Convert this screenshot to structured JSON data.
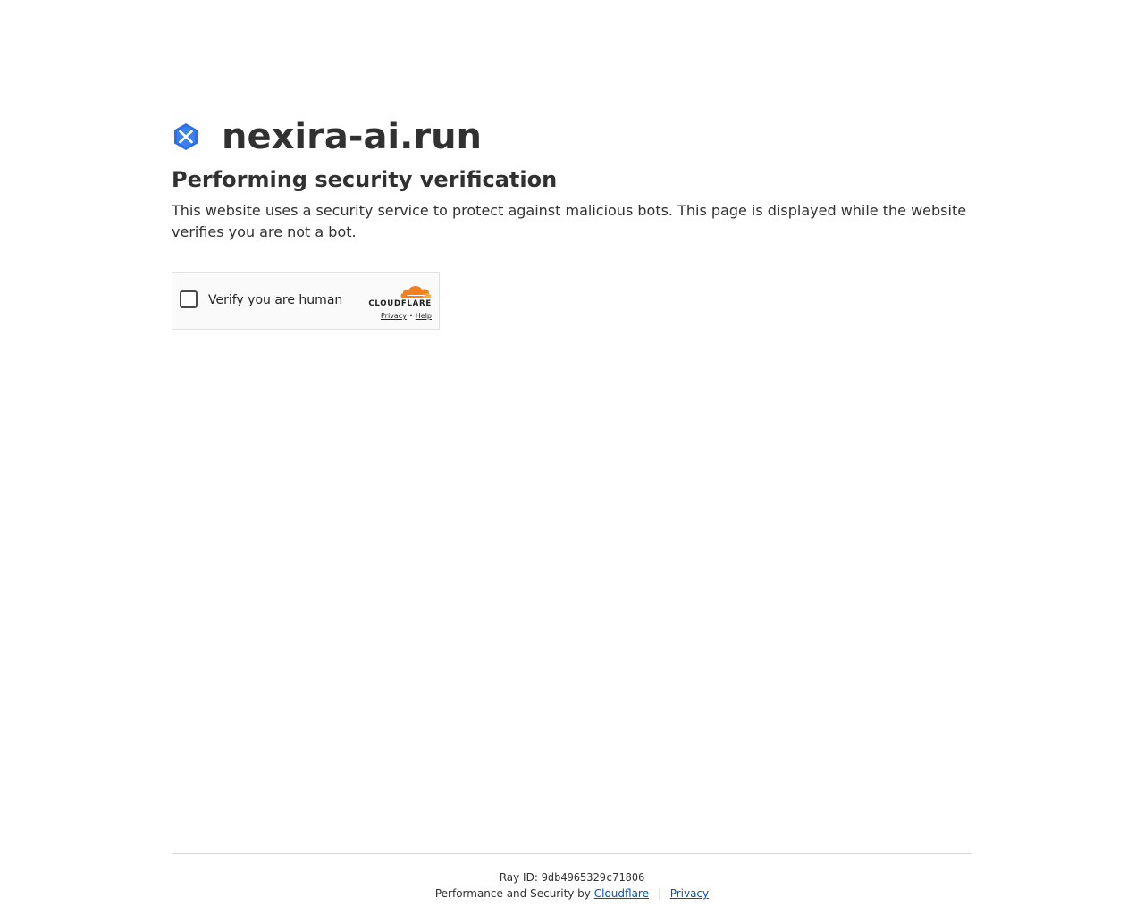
{
  "site": {
    "name": "nexira-ai.run",
    "logo_icon": "hexagon-brand-icon",
    "logo_color": "#2c6fe6"
  },
  "challenge": {
    "heading": "Performing security verification",
    "description": "This website uses a security service to protect against malicious bots. This page is displayed while the website verifies you are not a bot."
  },
  "widget": {
    "label": "Verify you are human",
    "checked": false,
    "brand_word": "CLOUDFLARE",
    "brand_color": "#f38020",
    "privacy_label": "Privacy",
    "separator": "•",
    "help_label": "Help"
  },
  "footer": {
    "ray_label": "Ray ID:",
    "ray_id": "9db4965329c71806",
    "performance_text": "Performance and Security by",
    "cloudflare_link": "Cloudflare",
    "divider": "|",
    "privacy_link": "Privacy"
  }
}
